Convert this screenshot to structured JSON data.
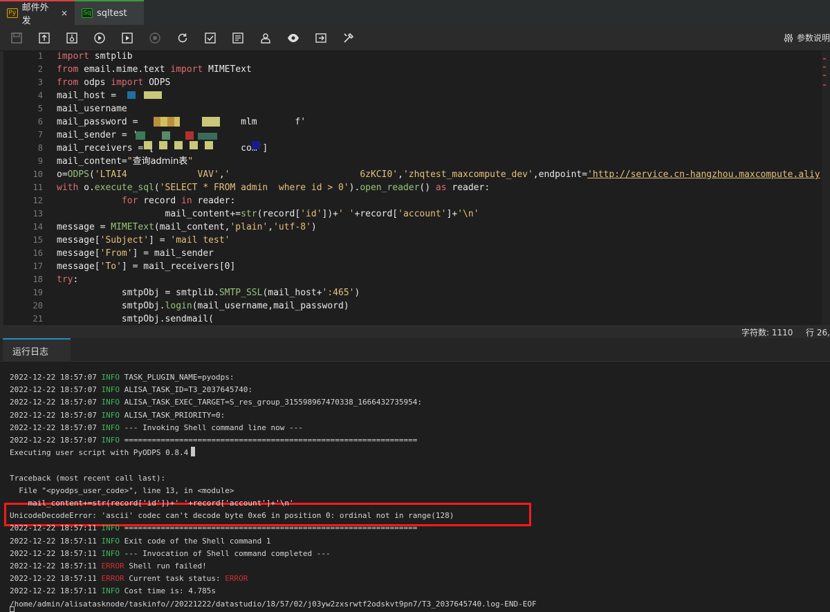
{
  "tabs": [
    {
      "badge": "Py",
      "label": "邮件外发",
      "close": "×"
    },
    {
      "badge": "Sq",
      "label": "sqltest"
    }
  ],
  "toolbar": {
    "buttons": [
      "save-icon",
      "upload-icon",
      "deploy-icon",
      "run-icon",
      "run-params-icon",
      "stop-icon",
      "refresh-icon",
      "check-icon",
      "format-icon",
      "person-icon",
      "eye-icon",
      "export-icon",
      "tools-icon"
    ],
    "params_label": "参数说明"
  },
  "editor": {
    "lines": [
      {
        "n": "1",
        "segs": [
          [
            "kw",
            "import"
          ],
          [
            "",
            " smtplib"
          ]
        ]
      },
      {
        "n": "2",
        "segs": [
          [
            "kw",
            "from"
          ],
          [
            "",
            " email.mime.text "
          ],
          [
            "kw",
            "import"
          ],
          [
            "",
            " MIMEText"
          ]
        ]
      },
      {
        "n": "3",
        "segs": [
          [
            "kw",
            "from"
          ],
          [
            "",
            " odps "
          ],
          [
            "kw",
            "import"
          ],
          [
            "",
            " ODPS"
          ]
        ]
      },
      {
        "n": "4",
        "segs": [
          [
            "",
            "mail_host = "
          ]
        ]
      },
      {
        "n": "5",
        "segs": [
          [
            "",
            "mail_username"
          ]
        ]
      },
      {
        "n": "6",
        "segs": [
          [
            "",
            "mail_password = "
          ],
          [
            "",
            "                  mlm       f'"
          ]
        ]
      },
      {
        "n": "7",
        "segs": [
          [
            "",
            "mail_sender = "
          ],
          [
            "str",
            "'"
          ]
        ]
      },
      {
        "n": "8",
        "segs": [
          [
            "",
            "mail_receivers = ['"
          ],
          [
            "",
            "               "
          ],
          [
            "",
            "com']"
          ]
        ]
      },
      {
        "n": "9",
        "segs": [
          [
            "",
            "mail_content="
          ],
          [
            "str",
            "\""
          ],
          [
            "cn",
            "查询admin表"
          ],
          [
            "str",
            "\""
          ]
        ]
      },
      {
        "n": "10",
        "segs": [
          [
            "",
            "o="
          ],
          [
            "fn",
            "ODPS"
          ],
          [
            "",
            "("
          ],
          [
            "str",
            "'LTAI4"
          ],
          [
            "",
            "             "
          ],
          [
            "str",
            "VAV'"
          ],
          [
            "",
            ","
          ],
          [
            "str",
            "'"
          ],
          [
            "",
            "                        "
          ],
          [
            "str",
            "6zKCI0'"
          ],
          [
            "",
            ","
          ],
          [
            "str",
            "'zhqtest_maxcompute_dev'"
          ],
          [
            "",
            ",endpoint="
          ],
          [
            "url",
            "'http://service.cn-hangzhou.maxcompute.aliy"
          ]
        ]
      },
      {
        "n": "11",
        "segs": [
          [
            "kw",
            "with"
          ],
          [
            "",
            " o."
          ],
          [
            "fn",
            "execute_sql"
          ],
          [
            "",
            "("
          ],
          [
            "str",
            "'SELECT * FROM admin  where id > 0'"
          ],
          [
            "",
            ")."
          ],
          [
            "fn",
            "open_reader"
          ],
          [
            "",
            "() "
          ],
          [
            "kw",
            "as"
          ],
          [
            "",
            " reader:"
          ]
        ]
      },
      {
        "n": "12",
        "segs": [
          [
            "",
            "            "
          ],
          [
            "kw",
            "for"
          ],
          [
            "",
            " record "
          ],
          [
            "kw",
            "in"
          ],
          [
            "",
            " reader:"
          ]
        ]
      },
      {
        "n": "13",
        "segs": [
          [
            "",
            "                    mail_content+="
          ],
          [
            "fn",
            "str"
          ],
          [
            "",
            "(record["
          ],
          [
            "str",
            "'id'"
          ],
          [
            "",
            "])+"
          ],
          [
            "str",
            "' '"
          ],
          [
            "",
            "+record["
          ],
          [
            "str",
            "'account'"
          ],
          [
            "",
            "]+"
          ],
          [
            "str",
            "'\\n'"
          ]
        ]
      },
      {
        "n": "14",
        "segs": [
          [
            "",
            "message = "
          ],
          [
            "fn",
            "MIMEText"
          ],
          [
            "",
            "(mail_content,"
          ],
          [
            "str",
            "'plain'"
          ],
          [
            "",
            ","
          ],
          [
            "str",
            "'utf-8'"
          ],
          [
            "",
            ")"
          ]
        ]
      },
      {
        "n": "15",
        "segs": [
          [
            "",
            "message["
          ],
          [
            "str",
            "'Subject'"
          ],
          [
            "",
            "] = "
          ],
          [
            "str",
            "'mail test'"
          ]
        ]
      },
      {
        "n": "16",
        "segs": [
          [
            "",
            "message["
          ],
          [
            "str",
            "'From'"
          ],
          [
            "",
            "] = mail_sender"
          ]
        ]
      },
      {
        "n": "17",
        "segs": [
          [
            "",
            "message["
          ],
          [
            "str",
            "'To'"
          ],
          [
            "",
            "] = mail_receivers[0]"
          ]
        ]
      },
      {
        "n": "18",
        "segs": [
          [
            "kw",
            "try"
          ],
          [
            "",
            ":"
          ]
        ]
      },
      {
        "n": "19",
        "segs": [
          [
            "",
            "            smtpObj = smtplib."
          ],
          [
            "fn",
            "SMTP_SSL"
          ],
          [
            "",
            "(mail_host+"
          ],
          [
            "str",
            "':465'"
          ],
          [
            "",
            ")"
          ]
        ]
      },
      {
        "n": "20",
        "segs": [
          [
            "",
            "            smtpObj."
          ],
          [
            "fn",
            "login"
          ],
          [
            "",
            "(mail_username,mail_password)"
          ]
        ]
      },
      {
        "n": "21",
        "segs": [
          [
            "",
            "            smtpObj.sendmail("
          ]
        ]
      }
    ]
  },
  "status": {
    "char_count": "字符数: 1110",
    "position": "行 26,"
  },
  "log": {
    "tab_label": "运行日志",
    "lines": [
      {
        "ts": "2022-12-22 18:57:07 ",
        "lvl": "INFO",
        "msg": " TASK_PLUGIN_NAME=pyodps:"
      },
      {
        "ts": "2022-12-22 18:57:07 ",
        "lvl": "INFO",
        "msg": " ALISA_TASK_ID=T3_2037645740:"
      },
      {
        "ts": "2022-12-22 18:57:07 ",
        "lvl": "INFO",
        "msg": " ALISA_TASK_EXEC_TARGET=S_res_group_315598967470338_1666432735954:"
      },
      {
        "ts": "2022-12-22 18:57:07 ",
        "lvl": "INFO",
        "msg": " ALISA_TASK_PRIORITY=0:"
      },
      {
        "ts": "2022-12-22 18:57:07 ",
        "lvl": "INFO",
        "msg": " --- Invoking Shell command line now ---"
      },
      {
        "ts": "2022-12-22 18:57:07 ",
        "lvl": "INFO",
        "msg": " ================================================================"
      },
      {
        "ts": "",
        "lvl": "",
        "msg": "Executing user script with PyODPS 0.8.4",
        "cursor": true
      },
      {
        "ts": "",
        "lvl": "",
        "msg": ""
      },
      {
        "ts": "",
        "lvl": "",
        "msg": "Traceback (most recent call last):"
      },
      {
        "ts": "",
        "lvl": "",
        "msg": "  File \"<pyodps_user_code>\", line 13, in <module>"
      },
      {
        "ts": "",
        "lvl": "",
        "msg": "    mail_content+=str(record['id'])+' '+record['account']+'\\n'"
      },
      {
        "ts": "",
        "lvl": "",
        "msg": "UnicodeDecodeError: 'ascii' codec can't decode byte 0xe6 in position 0: ordinal not in range(128)"
      },
      {
        "ts": "2022-12-22 18:57:11 ",
        "lvl": "INFO",
        "msg": " ================================================================"
      },
      {
        "ts": "2022-12-22 18:57:11 ",
        "lvl": "INFO",
        "msg": " Exit code of the Shell command 1"
      },
      {
        "ts": "2022-12-22 18:57:11 ",
        "lvl": "INFO",
        "msg": " --- Invocation of Shell command completed ---"
      },
      {
        "ts": "2022-12-22 18:57:11 ",
        "lvl": "ERROR",
        "msg": " Shell run failed!"
      },
      {
        "ts": "2022-12-22 18:57:11 ",
        "lvl": "ERROR",
        "msg": " Current task status: ",
        "tail": "ERROR"
      },
      {
        "ts": "2022-12-22 18:57:11 ",
        "lvl": "INFO",
        "msg": " Cost time is: 4.785s"
      },
      {
        "ts": "",
        "lvl": "",
        "msg": "/home/admin/alisatasknode/taskinfo//20221222/datastudio/18/57/02/j03yw2zxsrwtf2odskvt9pn7/T3_2037645740.log-END-EOF"
      }
    ]
  }
}
